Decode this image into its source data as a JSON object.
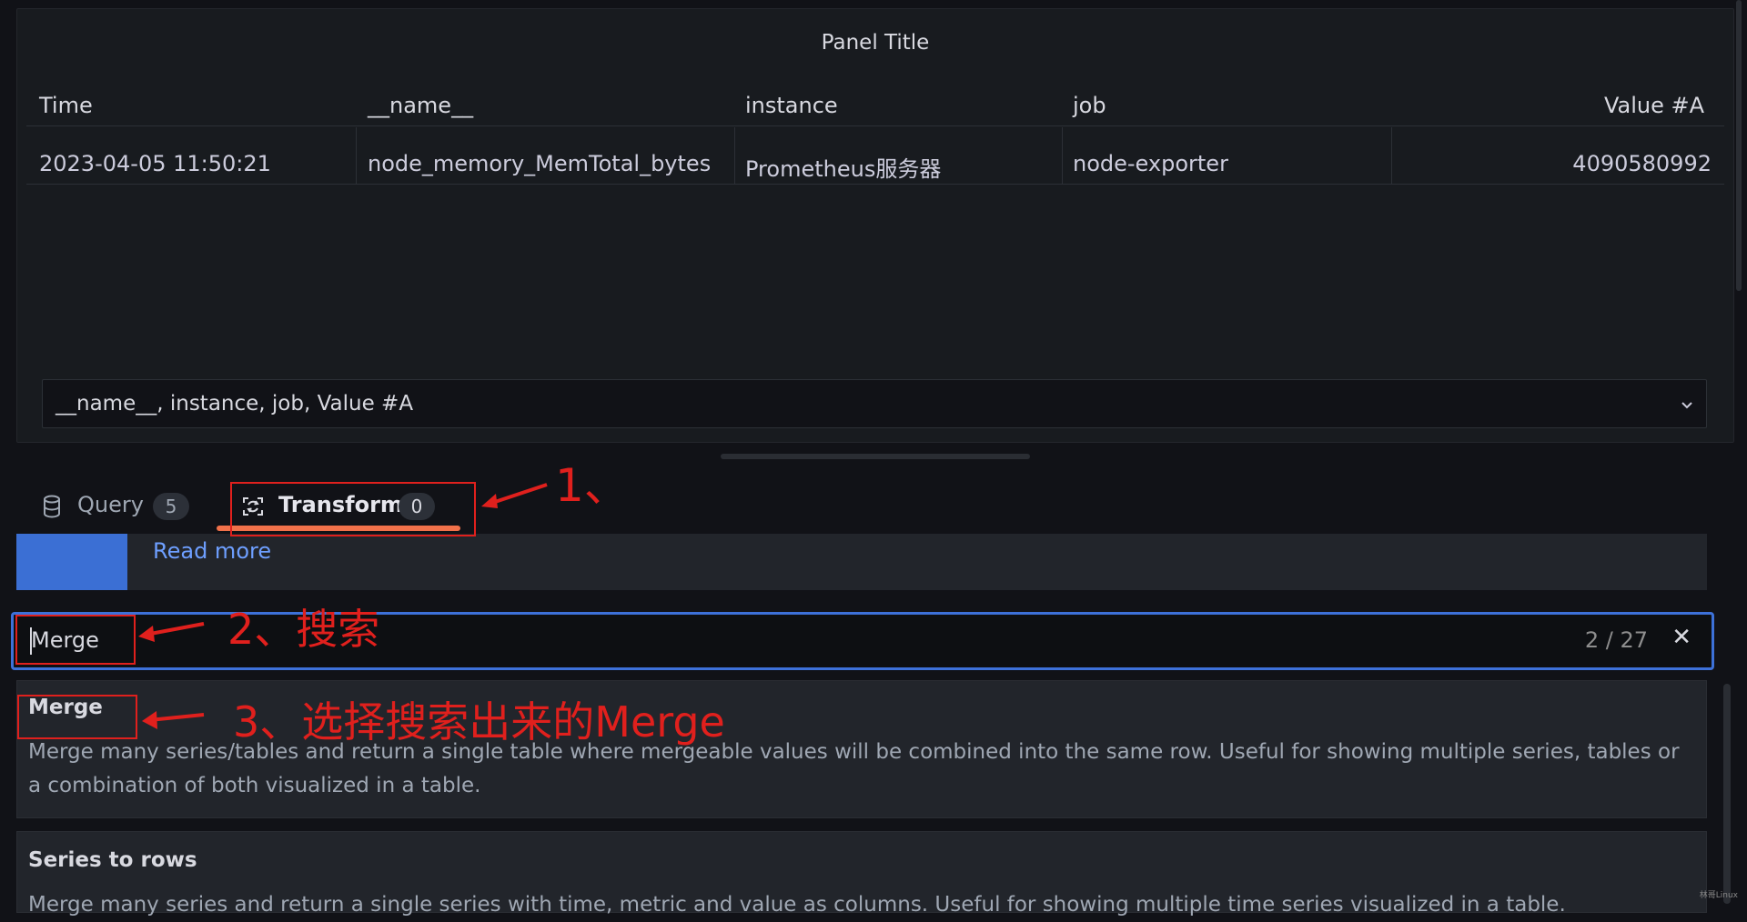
{
  "panel": {
    "title": "Panel Title",
    "columns": [
      "Time",
      "__name__",
      "instance",
      "job",
      "Value #A"
    ],
    "rows": [
      [
        "2023-04-05 11:50:21",
        "node_memory_MemTotal_bytes",
        "Prometheus服务器",
        "node-exporter",
        "4090580992"
      ]
    ],
    "footer_select": "__name__, instance, job, Value #A"
  },
  "tabs": [
    {
      "label": "Query",
      "count": "5",
      "icon": "database-icon"
    },
    {
      "label": "Transform",
      "count": "0",
      "icon": "transform-icon",
      "active": true
    }
  ],
  "help": {
    "read_more": "Read more"
  },
  "search": {
    "value": "Merge",
    "match_count": "2 / 27",
    "clear_icon": "close-icon"
  },
  "results": [
    {
      "title": "Merge",
      "description": "Merge many series/tables and return a single table where mergeable values will be combined into the same row. Useful for showing multiple series, tables or a combination of both visualized in a table."
    },
    {
      "title": "Series to rows",
      "description": "Merge many series and return a single series with time, metric and value as columns. Useful for showing multiple time series visualized in a table."
    }
  ],
  "annotations": {
    "step1": "1、",
    "step2": "2、搜索",
    "step3": "3、选择搜索出来的Merge"
  },
  "watermark": "林哥Linux",
  "colors": {
    "background": "#111217",
    "panel": "#181b1f",
    "accent_blue": "#3d71d9",
    "tab_underline": "#f1714a",
    "annotation_red": "#e0201d",
    "link": "#6e9fff"
  }
}
